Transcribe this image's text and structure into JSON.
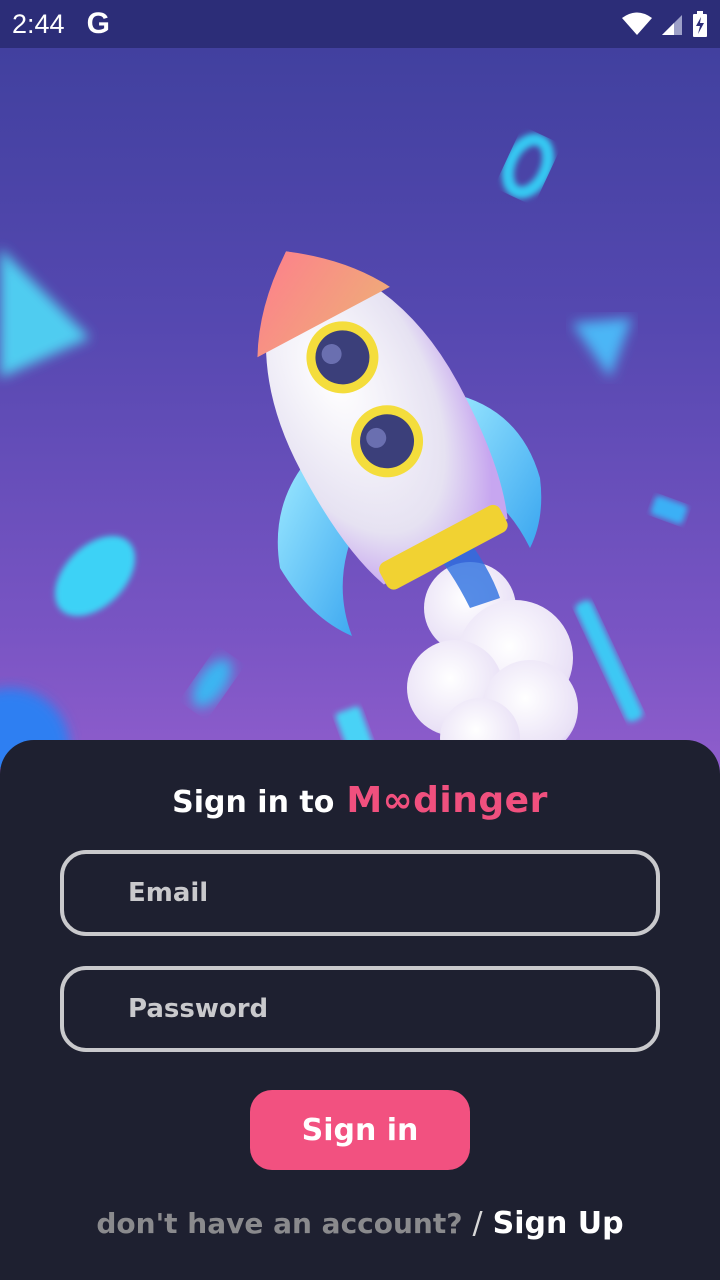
{
  "status_bar": {
    "time": "2:44",
    "app_letter": "G",
    "icons": [
      "wifi-icon",
      "signal-icon",
      "battery-charging-icon"
    ]
  },
  "hero": {
    "illustration": "rocket-illustration",
    "colors": {
      "bg_top": "#3e3f9c",
      "bg_bottom": "#8f5dcc"
    }
  },
  "login": {
    "title_prefix": "Sign in to",
    "brand": "M∞dinger",
    "email_placeholder": "Email",
    "password_placeholder": "Password",
    "signin_label": "Sign in",
    "footer_question": "don't have an account?",
    "footer_separator": "/",
    "signup_label": "Sign Up"
  },
  "colors": {
    "accent": "#f25180",
    "sheet_bg": "#1e2030",
    "field_border": "#c9c9cc"
  }
}
